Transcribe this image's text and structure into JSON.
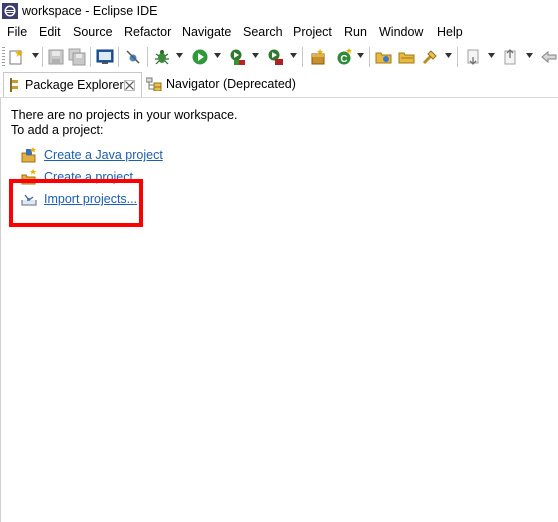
{
  "window": {
    "title": "workspace - Eclipse IDE",
    "app_icon": "eclipse-icon"
  },
  "menu": {
    "items": [
      "File",
      "Edit",
      "Source",
      "Refactor",
      "Navigate",
      "Search",
      "Project",
      "Run",
      "Window",
      "Help"
    ]
  },
  "toolbar": {
    "icons": [
      "new-icon",
      "save-icon",
      "save-all-icon",
      "terminal-icon",
      "skip-breakpoints-icon",
      "debug-icon",
      "run-icon",
      "coverage-icon",
      "external-tools-icon",
      "new-package-icon",
      "new-class-icon",
      "open-type-icon",
      "open-task-icon",
      "search-icon",
      "annotation-next-icon",
      "back-icon"
    ]
  },
  "tabs": [
    {
      "label": "Package Explorer",
      "icon": "package-explorer-icon",
      "active": true,
      "close_icon": "close-icon"
    },
    {
      "label": "Navigator (Deprecated)",
      "icon": "navigator-icon",
      "active": false
    }
  ],
  "content": {
    "message_line1": "There are no projects in your workspace.",
    "message_line2": "To add a project:",
    "links": [
      {
        "label": "Create a Java project",
        "icon": "new-java-project-icon"
      },
      {
        "label": "Create a project...",
        "icon": "new-project-icon"
      },
      {
        "label": "Import projects...",
        "icon": "import-icon"
      }
    ]
  },
  "highlight": {
    "color": "#ff0000",
    "target": "Import projects..."
  },
  "colors": {
    "link": "#1a5fb4",
    "background": "#ffffff"
  }
}
